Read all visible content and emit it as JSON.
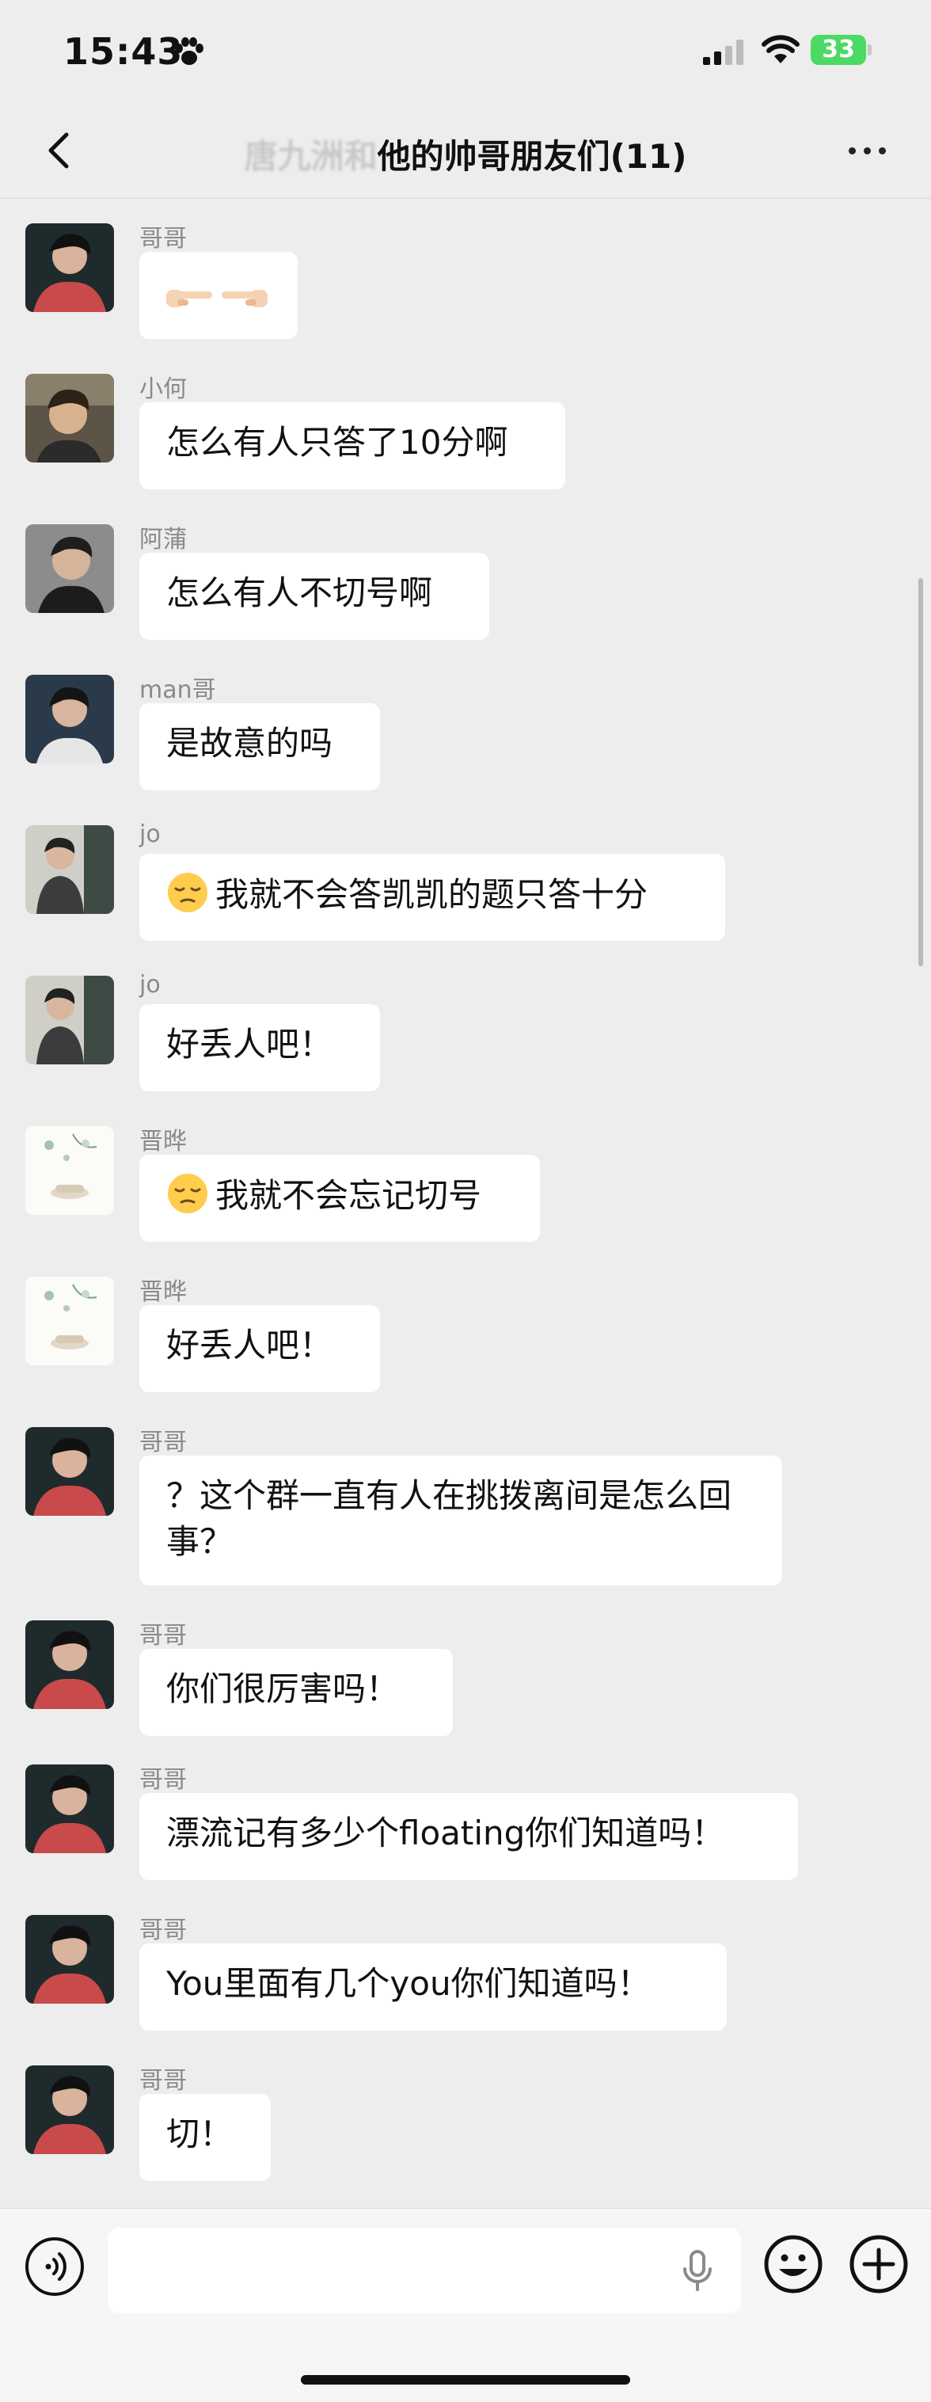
{
  "status_bar": {
    "time": "15:43",
    "battery": "33"
  },
  "nav": {
    "title_blurred": "唐九洲和",
    "title": "他的帅哥朋友们(11)"
  },
  "messages": [
    {
      "sender": "哥哥",
      "text": ""
    },
    {
      "sender": "小何",
      "text": "怎么有人只答了10分啊"
    },
    {
      "sender": "阿蒲",
      "text": "怎么有人不切号啊"
    },
    {
      "sender": "man哥",
      "text": "是故意的吗"
    },
    {
      "sender": "jo",
      "text": "我就不会答凯凯的题只答十分"
    },
    {
      "sender": "jo",
      "text": "好丢人吧！"
    },
    {
      "sender": "晋晔",
      "text": "我就不会忘记切号"
    },
    {
      "sender": "晋晔",
      "text": "好丢人吧！"
    },
    {
      "sender": "哥哥",
      "text": "？这个群一直有人在挑拨离间是怎么回事？"
    },
    {
      "sender": "哥哥",
      "text": "你们很厉害吗！"
    },
    {
      "sender": "哥哥",
      "text": "漂流记有多少个floating你们知道吗！"
    },
    {
      "sender": "哥哥",
      "text": "You里面有几个you你们知道吗！"
    },
    {
      "sender": "哥哥",
      "text": "切！"
    }
  ],
  "input": {
    "value": "",
    "placeholder": ""
  },
  "icons": {
    "back": "chevron-left-icon",
    "more": "more-icon",
    "voice": "voice-icon",
    "mic": "mic-icon",
    "emoji": "emoji-icon",
    "add": "plus-icon"
  }
}
